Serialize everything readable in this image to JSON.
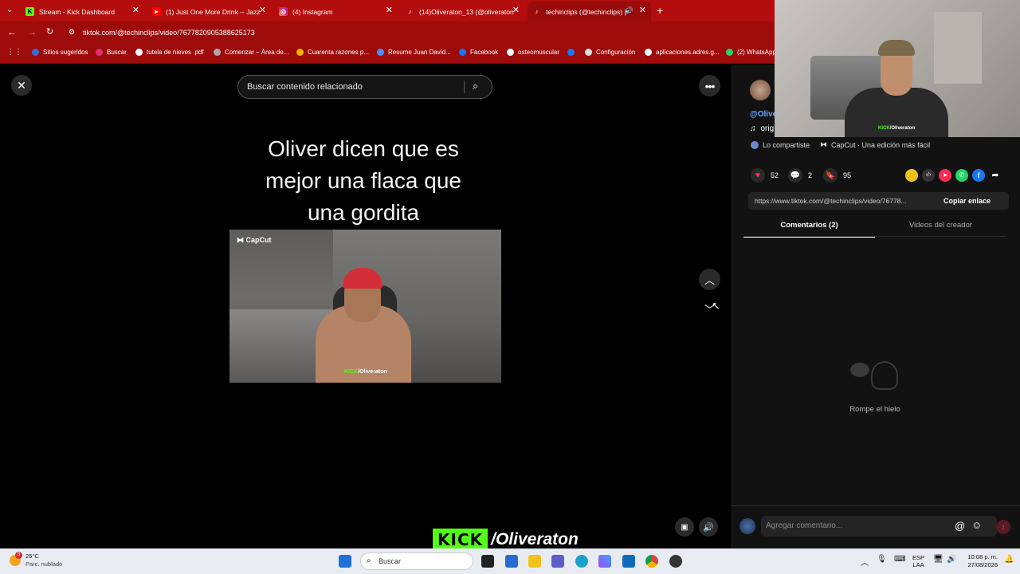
{
  "tabs": [
    {
      "label": "Stream - Kick Dashboard",
      "icon": "kick-icon",
      "color": "#53fc18"
    },
    {
      "label": "(1) Just One More Drink -- Jazz",
      "icon": "youtube-icon",
      "color": "#ff0000"
    },
    {
      "label": "(4) Instagram",
      "icon": "instagram-icon",
      "color": "#e1306c"
    },
    {
      "label": "(14)Oliveraton_13 (@oliveraton",
      "icon": "tiktok-icon",
      "color": "#000000"
    },
    {
      "label": "techinclips (@techinclips) |",
      "icon": "tiktok-icon",
      "color": "#000000"
    }
  ],
  "address": {
    "url": "tiktok.com/@techinclips/video/7677820905388625173"
  },
  "bookmarks": [
    "Sitios sugeridos",
    "Buscar",
    "tutela de nieves .pdf",
    "Comenzar – Área de...",
    "Cuarenta razones p...",
    "Resume Juan David...",
    "Facebook",
    "osteomuscular",
    "Configuración",
    "aplicaciones.adres.g...",
    "(2) WhatsApp"
  ],
  "search": {
    "placeholder": "Buscar contenido relacionado"
  },
  "video": {
    "caption": "Oliver dicen que es mejor una flaca que una gordita",
    "capcut_label": "CapCut",
    "kick_label": "KICK",
    "kick_handle": "/Oliveraton"
  },
  "author": {
    "handle": "@Olive",
    "sound": "orig"
  },
  "shared": {
    "label": "Lo compartiste",
    "app": "CapCut · Una edición más fácil"
  },
  "stats": {
    "likes": "52",
    "comments": "2",
    "saves": "95"
  },
  "link": {
    "url": "https://www.tiktok.com/@techinclips/video/76778...",
    "copy_label": "Copiar enlace"
  },
  "right_tabs": {
    "comments": "Comentarios (2)",
    "creator_videos": "Videos del creador"
  },
  "empty_state": "Rompe el hielo",
  "comment_input": {
    "placeholder": "Agregar comentario..."
  },
  "overlay": {
    "kick": "KICK",
    "handle": "/Oliveraton"
  },
  "webcam": {
    "kick": "KICK",
    "handle": "/Oliveraton"
  },
  "taskbar": {
    "weather_temp": "25°C",
    "weather_desc": "Parc. nublado",
    "weather_badge": "3",
    "search_label": "Buscar",
    "lang1": "ESP",
    "lang2": "LAA",
    "time": "10:08 p. m.",
    "date": "27/08/2026"
  },
  "colors": {
    "tab_bar": "#b30d0d",
    "kick_green": "#53fc18",
    "accent_red": "#fe2c55",
    "panel": "#121212"
  }
}
